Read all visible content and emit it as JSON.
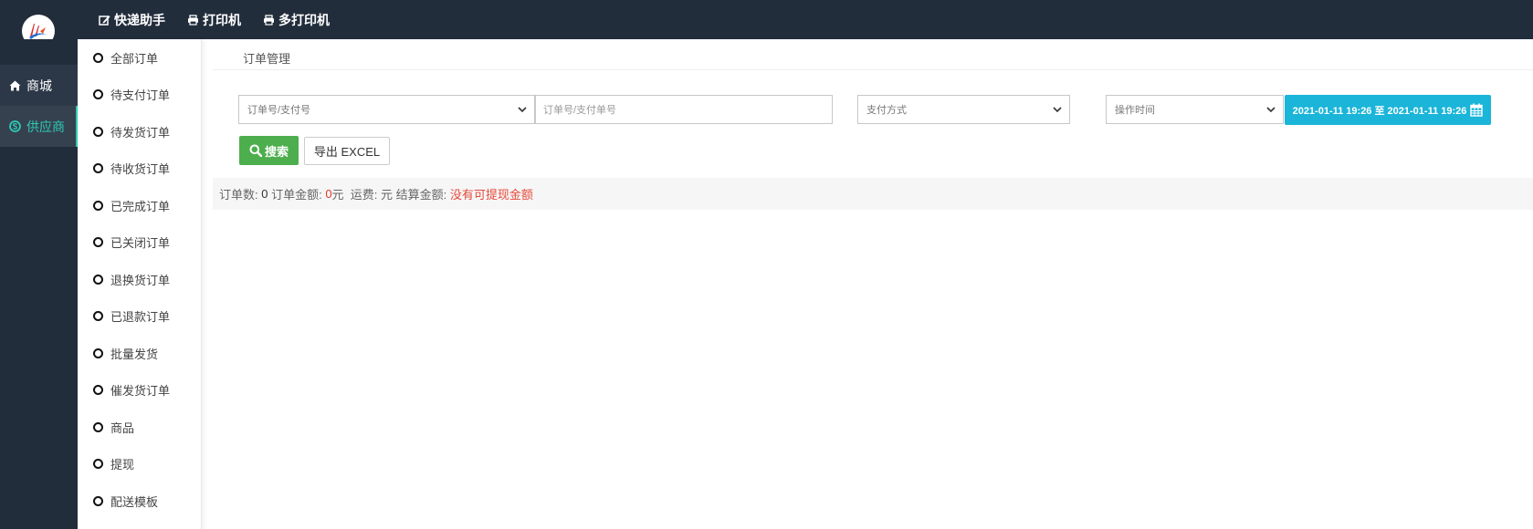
{
  "top_nav": [
    {
      "label": "快递助手",
      "icon": "edit-icon"
    },
    {
      "label": "打印机",
      "icon": "printer-icon"
    },
    {
      "label": "多打印机",
      "icon": "printer-icon"
    }
  ],
  "left_nav": [
    {
      "label": "商城",
      "icon": "home-icon"
    },
    {
      "label": "供应商",
      "icon": "skype-icon",
      "active": true
    }
  ],
  "sub_nav": [
    "全部订单",
    "待支付订单",
    "待发货订单",
    "待收货订单",
    "已完成订单",
    "已关闭订单",
    "退换货订单",
    "已退款订单",
    "批量发货",
    "催发货订单",
    "商品",
    "提现",
    "配送模板"
  ],
  "breadcrumb": "订单管理",
  "filters": {
    "order_type_select": "订单号/支付号",
    "order_no_placeholder": "订单号/支付单号",
    "pay_method_select": "支付方式",
    "time_type_select": "操作时间",
    "date_range": "2021-01-11 19:26 至 2021-01-11 19:26"
  },
  "buttons": {
    "search": "搜索",
    "export": "导出 EXCEL"
  },
  "summary": {
    "order_count_label": "订单数: ",
    "order_count": "0",
    "order_amount_label": " 订单金额: ",
    "order_amount": "0",
    "yuan": "元",
    "freight_label": "  运费: 元 结算金额: ",
    "settle_link": "没有可提现金额"
  },
  "colors": {
    "dark": "#222d3c",
    "accent": "#2ec9b5",
    "info": "#1ab5d8",
    "success": "#4cae4c",
    "danger": "#e0362b"
  }
}
